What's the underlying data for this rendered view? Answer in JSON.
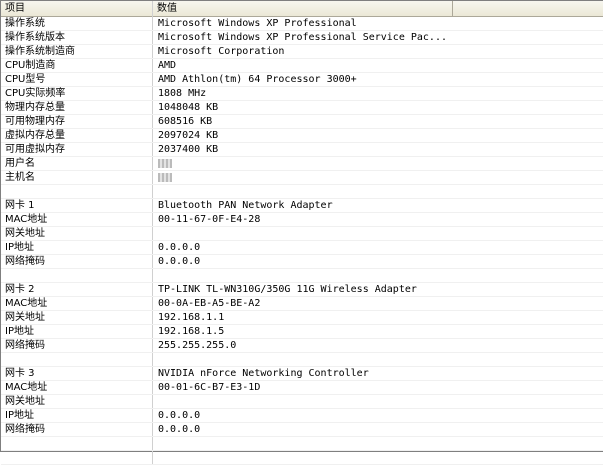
{
  "header": {
    "col_item": "项目",
    "col_value": "数值"
  },
  "rows": [
    {
      "label": "操作系统",
      "value": "Microsoft Windows XP Professional"
    },
    {
      "label": "操作系统版本",
      "value": "Microsoft Windows XP Professional Service Pac..."
    },
    {
      "label": "操作系统制造商",
      "value": "Microsoft Corporation"
    },
    {
      "label": "CPU制造商",
      "value": "AMD"
    },
    {
      "label": "CPU型号",
      "value": "AMD Athlon(tm) 64 Processor 3000+"
    },
    {
      "label": "CPU实际频率",
      "value": "1808 MHz"
    },
    {
      "label": "物理内存总量",
      "value": "1048048 KB"
    },
    {
      "label": "可用物理内存",
      "value": "608516 KB"
    },
    {
      "label": "虚拟内存总量",
      "value": "2097024 KB"
    },
    {
      "label": "可用虚拟内存",
      "value": "2037400 KB"
    },
    {
      "label": "用户名",
      "value": ""
    },
    {
      "label": "主机名",
      "value": ""
    },
    {
      "label": "",
      "value": ""
    },
    {
      "label": "网卡 1",
      "value": "Bluetooth PAN Network Adapter"
    },
    {
      "label": "MAC地址",
      "value": "00-11-67-0F-E4-28"
    },
    {
      "label": "网关地址",
      "value": ""
    },
    {
      "label": "IP地址",
      "value": "0.0.0.0"
    },
    {
      "label": "网络掩码",
      "value": "0.0.0.0"
    },
    {
      "label": "",
      "value": ""
    },
    {
      "label": "网卡 2",
      "value": "TP-LINK TL-WN310G/350G 11G Wireless Adapter"
    },
    {
      "label": "MAC地址",
      "value": "00-0A-EB-A5-BE-A2"
    },
    {
      "label": "网关地址",
      "value": "192.168.1.1"
    },
    {
      "label": "IP地址",
      "value": "192.168.1.5"
    },
    {
      "label": "网络掩码",
      "value": "255.255.255.0"
    },
    {
      "label": "",
      "value": ""
    },
    {
      "label": "网卡 3",
      "value": "NVIDIA nForce Networking Controller"
    },
    {
      "label": "MAC地址",
      "value": "00-01-6C-B7-E3-1D"
    },
    {
      "label": "网关地址",
      "value": ""
    },
    {
      "label": "IP地址",
      "value": "0.0.0.0"
    },
    {
      "label": "网络掩码",
      "value": "0.0.0.0"
    },
    {
      "label": "",
      "value": ""
    },
    {
      "label": "",
      "value": ""
    }
  ]
}
